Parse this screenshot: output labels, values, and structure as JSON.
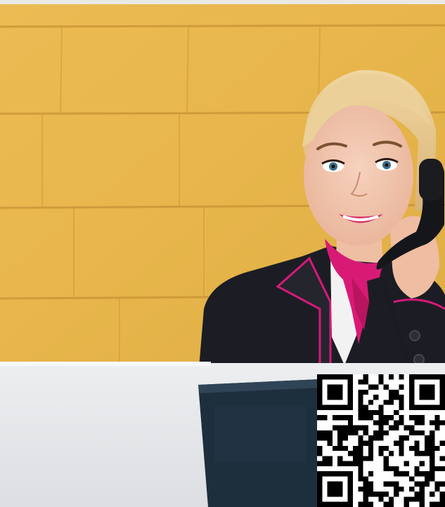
{
  "photo": {
    "subject": "hotel-receptionist-on-phone",
    "colors": {
      "wall": "#e8b545",
      "wall_mortar": "#c9922b",
      "jacket": "#1c1d24",
      "jacket_trim": "#d8187a",
      "scarf": "#d81a75",
      "hair": "#e7c98c",
      "skin": "#f1c4ac",
      "desk": "#e7e8ea",
      "monitor": "#1d2e3d"
    }
  },
  "qr_code": {
    "icon": "qr-code-icon",
    "seed": 9
  }
}
